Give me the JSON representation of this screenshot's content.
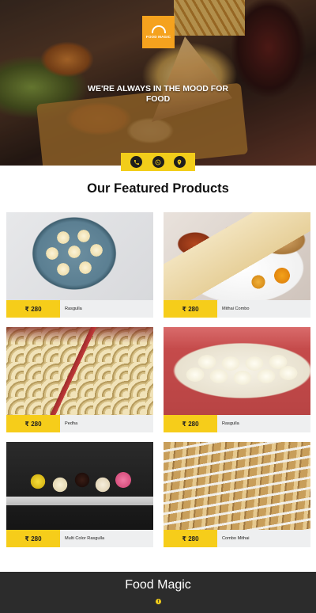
{
  "hero": {
    "logo_text": "FOOD MAGIC",
    "tagline": "WE'RE ALWAYS IN THE MOOD FOR FOOD",
    "contact_icons": [
      "phone-icon",
      "whatsapp-icon",
      "location-pin-icon"
    ]
  },
  "featured": {
    "title": "Our Featured Products",
    "products": [
      {
        "price": "₹ 280",
        "name": "Rasgulla"
      },
      {
        "price": "₹ 280",
        "name": "Mithai Combo"
      },
      {
        "price": "₹ 280",
        "name": "Pedha"
      },
      {
        "price": "₹ 280",
        "name": "Rasgulla"
      },
      {
        "price": "₹ 280",
        "name": "Multi Color Rasgulla"
      },
      {
        "price": "₹ 280",
        "name": "Combo Mithai"
      }
    ]
  },
  "footer": {
    "brand": "Food Magic",
    "social_icon": "facebook-icon"
  },
  "colors": {
    "accent_yellow": "#f2cd1a",
    "logo_orange": "#f5a21e",
    "footer_bg": "#2c2c2c",
    "card_bg": "#eeeff0"
  }
}
